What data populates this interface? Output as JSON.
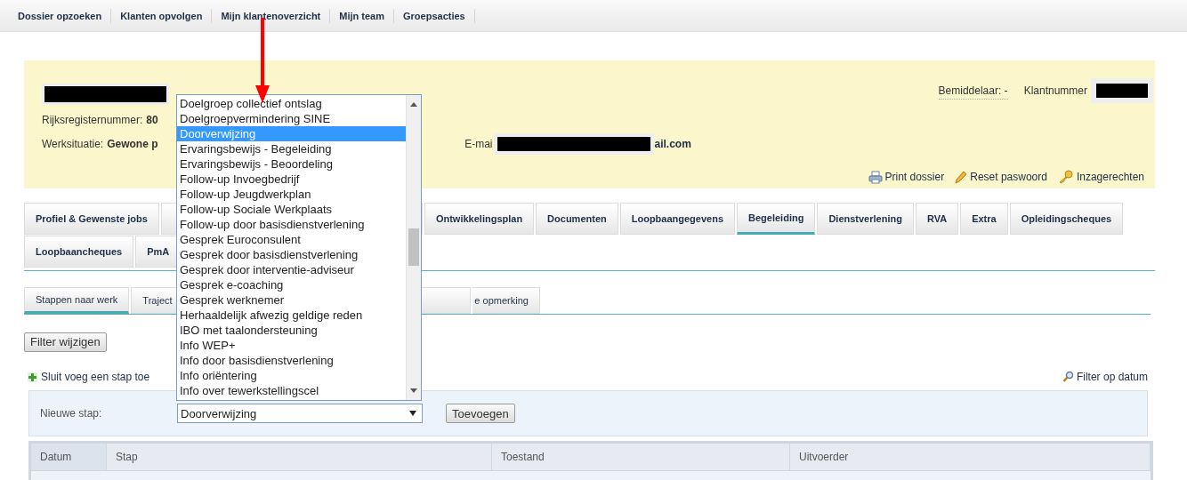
{
  "top_nav": [
    {
      "label": "Dossier opzoeken"
    },
    {
      "label": "Klanten opvolgen"
    },
    {
      "label": "Mijn klantenoverzicht"
    },
    {
      "label": "Mijn team"
    },
    {
      "label": "Groepsacties"
    }
  ],
  "client_header": {
    "bemiddelaar": "Bemiddelaar: -",
    "klantnummer_label": "Klantnummer",
    "rijksregister_label": "Rijksregisternummer:",
    "rijksregister_value": "80",
    "werksituatie_label": "Werksituatie:",
    "werksituatie_value": "Gewone p",
    "email_label": "E-mai",
    "email_value": "ail.com",
    "actions": [
      {
        "kind": "print",
        "label": "Print dossier"
      },
      {
        "kind": "pencil",
        "label": "Reset paswoord"
      },
      {
        "kind": "key",
        "label": "Inzagerechten"
      }
    ]
  },
  "main_tabs": [
    [
      {
        "kind": "normal",
        "label": "Profiel & Gewenste jobs",
        "selected": false
      },
      {
        "kind": "covered",
        "selected": false
      },
      {
        "kind": "normal",
        "label": "Ontwikkelingsplan",
        "selected": false
      },
      {
        "kind": "normal",
        "label": "Documenten",
        "selected": false
      },
      {
        "kind": "normal",
        "label": "Loopbaangegevens",
        "selected": false
      },
      {
        "kind": "normal",
        "label": "Begeleiding",
        "selected": true
      },
      {
        "kind": "normal",
        "label": "Dienstverlening",
        "selected": false
      },
      {
        "kind": "normal",
        "label": "RVA",
        "selected": false
      },
      {
        "kind": "normal",
        "label": "Extra",
        "selected": false
      },
      {
        "kind": "normal",
        "label": "Opleidingscheques",
        "selected": false
      }
    ],
    [
      {
        "kind": "normal",
        "label": "Loopbaancheques",
        "selected": false
      },
      {
        "kind": "cut",
        "label": "PmA",
        "selected": false
      }
    ]
  ],
  "sub_tabs": [
    {
      "kind": "normal",
      "label": "Stappen naar werk",
      "selected": true
    },
    {
      "kind": "cut",
      "label": "Traject",
      "selected": false
    },
    {
      "kind": "covered",
      "selected": false
    },
    {
      "kind": "partial",
      "label": "e opmerking",
      "selected": false
    }
  ],
  "filter_button": "Filter wijzigen",
  "add_step_link": "Sluit voeg een stap toe",
  "filter_date_link": "Filter op datum",
  "new_step": {
    "label": "Nieuwe stap:",
    "value": "Doorverwijzing",
    "button": "Toevoegen",
    "options": [
      {
        "label": "Doelgroep collectief ontslag",
        "selected": false
      },
      {
        "label": "Doelgroepvermindering SINE",
        "selected": false
      },
      {
        "label": "Doorverwijzing",
        "selected": true
      },
      {
        "label": "Ervaringsbewijs - Begeleiding",
        "selected": false
      },
      {
        "label": "Ervaringsbewijs - Beoordeling",
        "selected": false
      },
      {
        "label": "Follow-up Invoegbedrijf",
        "selected": false
      },
      {
        "label": "Follow-up Jeugdwerkplan",
        "selected": false
      },
      {
        "label": "Follow-up Sociale Werkplaats",
        "selected": false
      },
      {
        "label": "Follow-up door basisdienstverlening",
        "selected": false
      },
      {
        "label": "Gesprek Euroconsulent",
        "selected": false
      },
      {
        "label": "Gesprek door basisdienstverlening",
        "selected": false
      },
      {
        "label": "Gesprek door interventie-adviseur",
        "selected": false
      },
      {
        "label": "Gesprek e-coaching",
        "selected": false
      },
      {
        "label": "Gesprek werknemer",
        "selected": false
      },
      {
        "label": "Herhaaldelijk afwezig geldige reden",
        "selected": false
      },
      {
        "label": "IBO met taalondersteuning",
        "selected": false
      },
      {
        "label": "Info WEP+",
        "selected": false
      },
      {
        "label": "Info door basisdienstverlening",
        "selected": false
      },
      {
        "label": "Info oriëntering",
        "selected": false
      },
      {
        "label": "Info over tewerkstellingscel",
        "selected": false
      }
    ]
  },
  "table": {
    "columns": [
      "Datum",
      "Stap",
      "Toestand",
      "Uitvoerder"
    ]
  }
}
